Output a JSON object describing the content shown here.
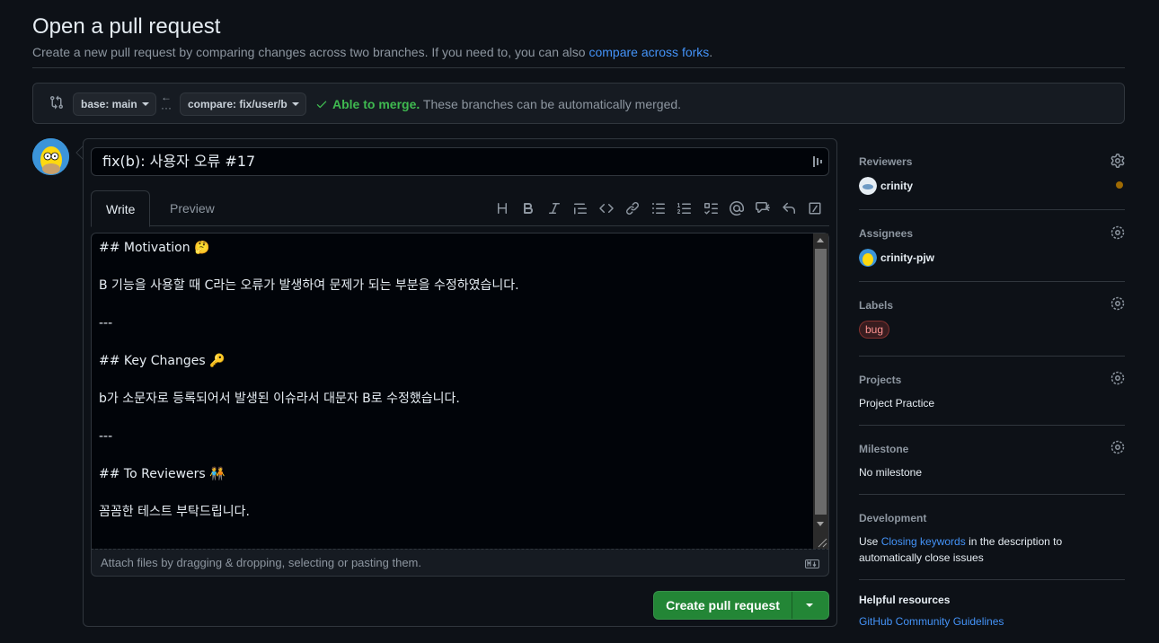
{
  "header": {
    "title": "Open a pull request",
    "subtitle_text": "Create a new pull request by comparing changes across two branches. If you need to, you can also ",
    "subtitle_link": "compare across forks",
    "subtitle_end": "."
  },
  "range": {
    "base_label": "base: main",
    "compare_label": "compare: fix/user/b",
    "merge_ok": "Able to merge.",
    "merge_detail": " These branches can be automatically merged."
  },
  "composer": {
    "title_value": "fix(b): 사용자 오류 #17",
    "tabs": [
      "Write",
      "Preview"
    ],
    "toolbar_icons": [
      "heading-icon",
      "bold-icon",
      "italic-icon",
      "quote-icon",
      "code-icon",
      "link-icon",
      "unordered-list-icon",
      "ordered-list-icon",
      "task-list-icon",
      "mention-icon",
      "cross-reference-icon",
      "saved-reply-icon",
      "slash-command-icon"
    ],
    "body_lines": [
      "## Motivation 🤔",
      "",
      "B 기능을 사용할 때 C라는 오류가 발생하여 문제가 되는 부분을 수정하였습니다.",
      "",
      "---",
      "",
      "## Key Changes 🔑",
      "",
      "b가 소문자로 등록되어서 발생된 이슈라서 대문자 B로 수정했습니다.",
      "",
      "---",
      "",
      "## To Reviewers 🧑‍🤝‍🧑",
      "",
      "꼼꼼한 테스트 부탁드립니다."
    ],
    "attach_hint": "Attach files by dragging & dropping, selecting or pasting them.",
    "create_label": "Create pull request"
  },
  "sidebar": {
    "reviewers": {
      "heading": "Reviewers",
      "user": "crinity"
    },
    "assignees": {
      "heading": "Assignees",
      "user": "crinity-pjw"
    },
    "labels": {
      "heading": "Labels",
      "label": "bug"
    },
    "projects": {
      "heading": "Projects",
      "value": "Project Practice"
    },
    "milestone": {
      "heading": "Milestone",
      "value": "No milestone"
    },
    "development": {
      "heading": "Development",
      "text_before": "Use ",
      "link": "Closing keywords",
      "text_after": " in the description to",
      "line2": "automatically close issues"
    },
    "helpful": {
      "heading": "Helpful resources",
      "link": "GitHub Community Guidelines"
    }
  },
  "colors": {
    "background": "#0d1117",
    "accent_link": "#4493f8",
    "success": "#3fb950",
    "primary_button": "#238636",
    "label_bug": "#ff9492"
  }
}
